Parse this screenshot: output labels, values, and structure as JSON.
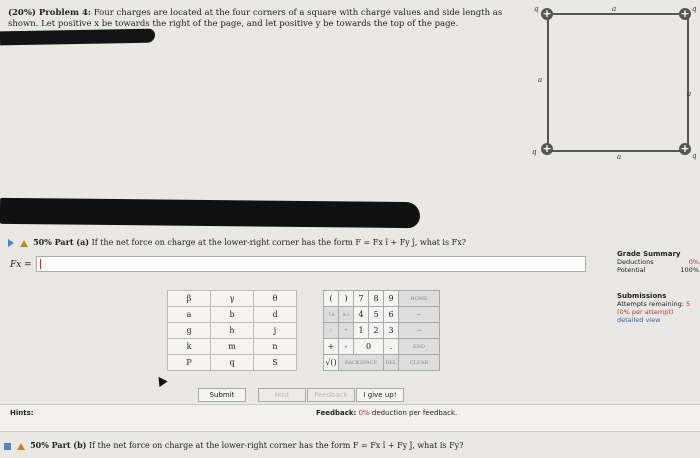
{
  "problem": {
    "heading": "(20%) Problem 4:",
    "text": "Four charges are located at the four corners of a square with charge values and side length as shown. Let positive x be towards the right of the page, and let positive y be towards the top of the page."
  },
  "diagram": {
    "charge_labels": [
      "q",
      "q",
      "q",
      "q"
    ],
    "side_labels": [
      "a",
      "a",
      "a",
      "a"
    ]
  },
  "part_a": {
    "label": "50% Part (a)",
    "question": "If the net force on charge at the lower-right corner has the form F = Fx î + Fy ĵ, what is Fx?",
    "input_label": "Fx =",
    "input_value": ""
  },
  "grade_summary": {
    "title": "Grade Summary",
    "deductions_label": "Deductions",
    "deductions_value": "0%",
    "potential_label": "Potential",
    "potential_value": "100%"
  },
  "submissions": {
    "title": "Submissions",
    "attempts_label": "Attempts remaining:",
    "attempts_value": "5",
    "per_attempt": "(0% per attempt)",
    "detailed_view": "detailed view"
  },
  "symbols": [
    [
      "β",
      "γ",
      "θ"
    ],
    [
      "a",
      "b",
      "d"
    ],
    [
      "g",
      "h",
      "j"
    ],
    [
      "k",
      "m",
      "n"
    ],
    [
      "P",
      "q",
      "S"
    ]
  ],
  "keypad": {
    "rows": [
      [
        "(",
        ")",
        "7",
        "8",
        "9",
        "HOME"
      ],
      [
        "↑A",
        "A↓",
        "4",
        "5",
        "6",
        "←"
      ],
      [
        "/",
        "*",
        "1",
        "2",
        "3",
        "→"
      ],
      [
        "+",
        "-",
        "0",
        ".",
        "END"
      ],
      [
        "√()",
        "BACKSPACE",
        "DEL",
        "CLEAR"
      ]
    ]
  },
  "buttons": {
    "submit": "Submit",
    "hint": "Hint",
    "feedback": "Feedback",
    "give_up": "I give up!"
  },
  "hints": {
    "label": "Hints:",
    "feedback_label": "Feedback:",
    "feedback_value": "0%",
    "feedback_text": "deduction per feedback."
  },
  "part_b": {
    "label": "50% Part (b)",
    "question": "If the net force on charge at the lower-right corner has the form F = Fx î + Fy ĵ, what is Fy?"
  }
}
